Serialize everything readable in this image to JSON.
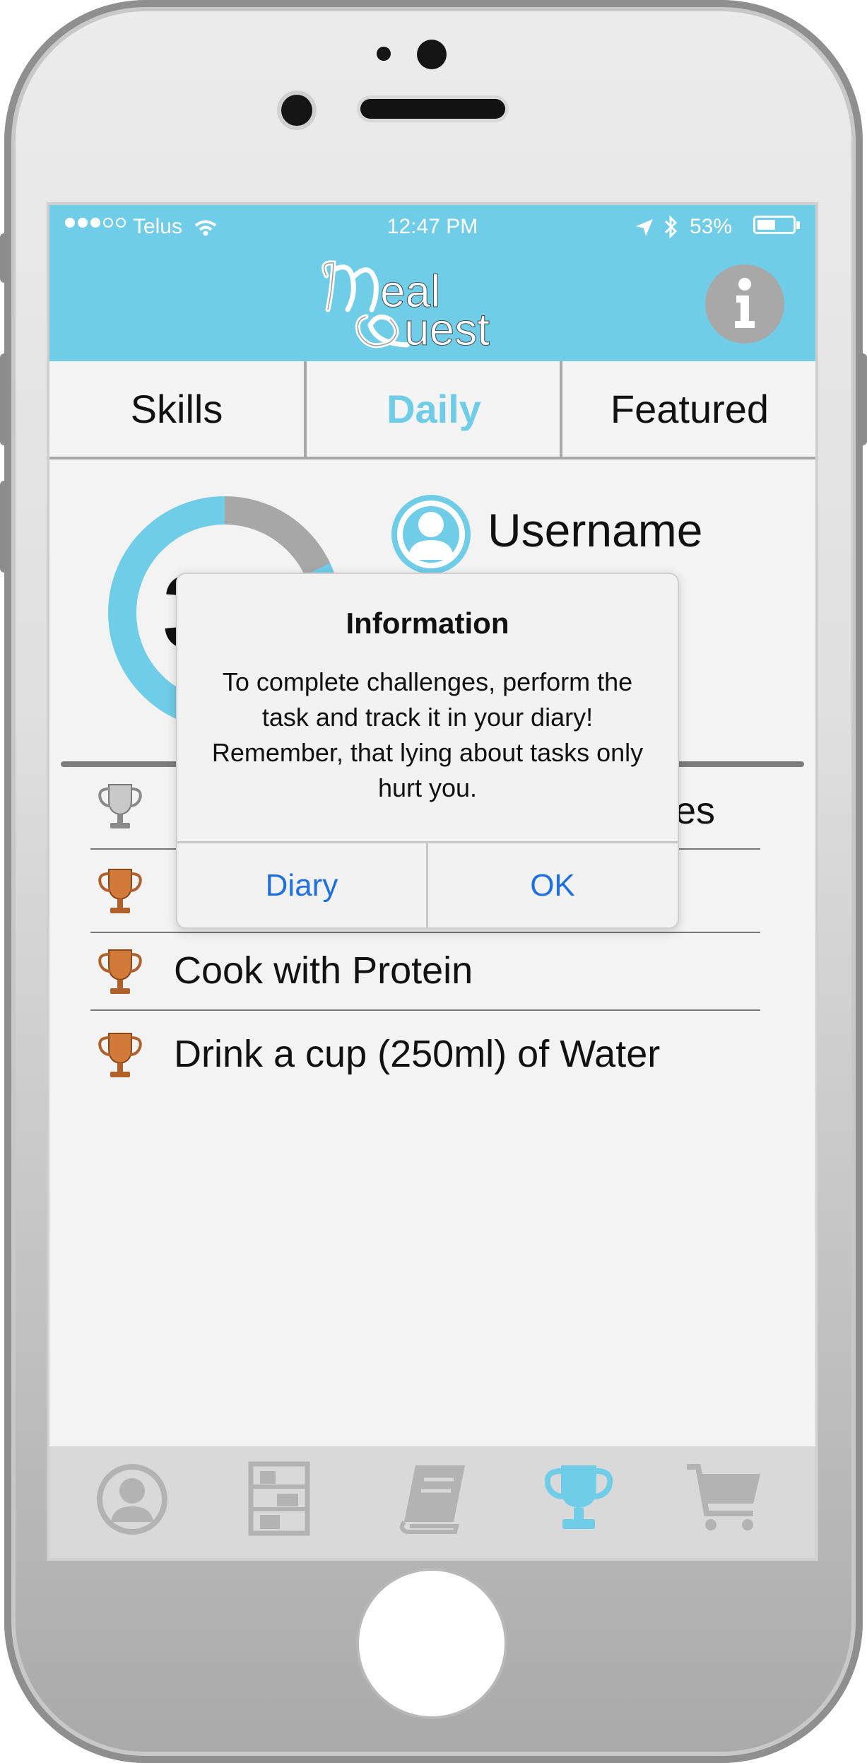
{
  "status_bar": {
    "carrier": "Telus",
    "time": "12:47 PM",
    "battery": "53%",
    "battery_level": 0.53,
    "signal_bars_full": 3,
    "signal_bars_total": 5,
    "icons": [
      "wifi-icon",
      "location-arrow-icon",
      "bluetooth-icon",
      "battery-icon"
    ]
  },
  "header": {
    "logo_text": "MealQuest",
    "info_button": "info-icon",
    "accent_color": "#6fcde8"
  },
  "tabs": [
    {
      "label": "Skills",
      "active": false
    },
    {
      "label": "Daily",
      "active": true
    },
    {
      "label": "Featured",
      "active": false
    }
  ],
  "profile": {
    "username": "Username",
    "level_partial": "3",
    "progress_fraction": 0.82
  },
  "challenges": [
    {
      "label": "",
      "trailing_text": "es",
      "trophy": "silver"
    },
    {
      "label": "",
      "trophy": "bronze"
    },
    {
      "label": "Cook with Protein",
      "trophy": "bronze"
    },
    {
      "label": "Drink a cup (250ml) of Water",
      "trophy": "bronze"
    }
  ],
  "dialog": {
    "title": "Information",
    "message": "To complete challenges, perform the task and track it in your diary! Remember, that lying about tasks only hurt you.",
    "buttons": {
      "left": "Diary",
      "right": "OK"
    }
  },
  "tab_bar": [
    {
      "icon": "profile-icon",
      "active": false
    },
    {
      "icon": "shelves-icon",
      "active": false
    },
    {
      "icon": "book-icon",
      "active": false
    },
    {
      "icon": "trophy-icon",
      "active": true
    },
    {
      "icon": "cart-icon",
      "active": false
    }
  ]
}
